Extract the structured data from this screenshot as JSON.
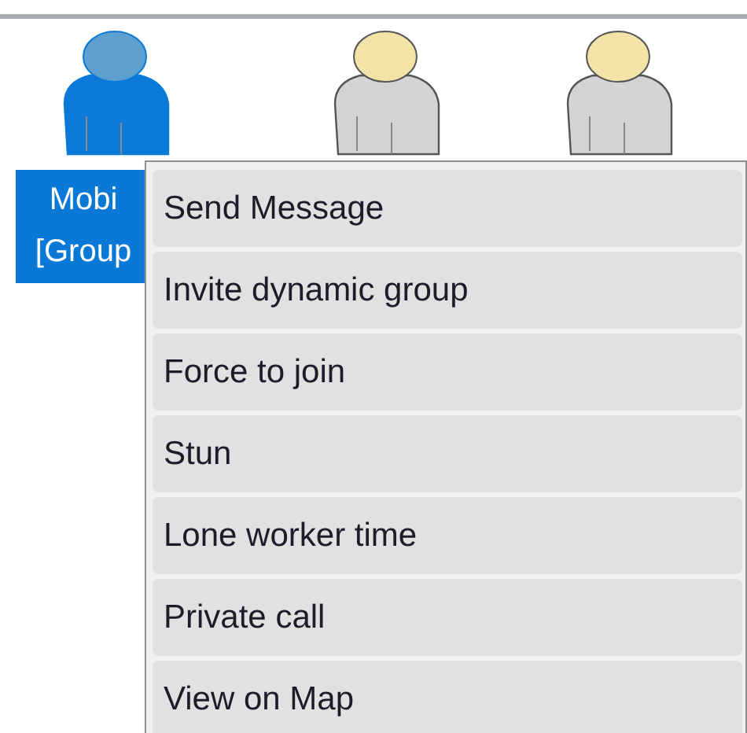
{
  "users": [
    {
      "selected": true,
      "label_lines": [
        "Mobi",
        "[Group"
      ]
    },
    {
      "selected": false
    },
    {
      "selected": false
    }
  ],
  "context_menu": {
    "items": [
      {
        "label": "Send Message"
      },
      {
        "label": "Invite dynamic group"
      },
      {
        "label": "Force to join"
      },
      {
        "label": "Stun"
      },
      {
        "label": "Lone worker time"
      },
      {
        "label": "Private call"
      },
      {
        "label": "View on Map"
      }
    ]
  }
}
